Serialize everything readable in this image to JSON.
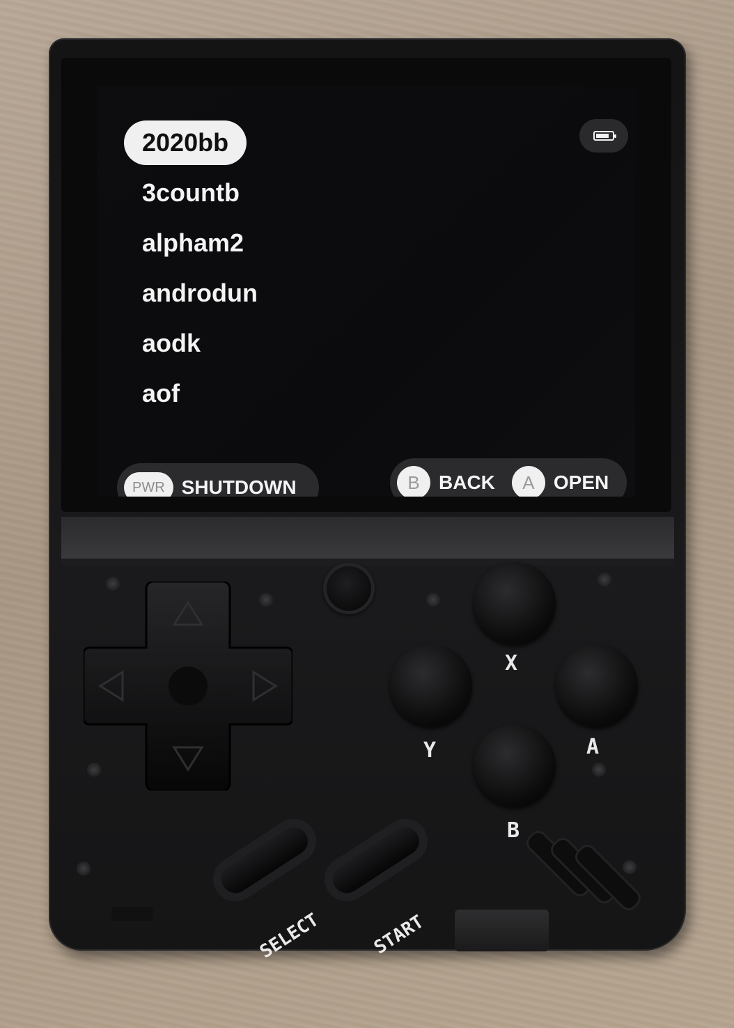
{
  "rom_list": {
    "items": [
      {
        "label": "2020bb",
        "selected": true
      },
      {
        "label": "3countb",
        "selected": false
      },
      {
        "label": "alpham2",
        "selected": false
      },
      {
        "label": "androdun",
        "selected": false
      },
      {
        "label": "aodk",
        "selected": false
      },
      {
        "label": "aof",
        "selected": false
      }
    ]
  },
  "status": {
    "battery_icon": "battery-icon",
    "battery_level": 0.8
  },
  "footer": {
    "shutdown": {
      "key": "PWR",
      "label": "SHUTDOWN"
    },
    "back": {
      "key": "B",
      "label": "BACK"
    },
    "open": {
      "key": "A",
      "label": "OPEN"
    }
  },
  "device": {
    "button_labels": {
      "x": "X",
      "y": "Y",
      "a": "A",
      "b": "B"
    },
    "select_label": "SELECT",
    "start_label": "START",
    "colors": {
      "body": "#141414",
      "screen": "#0d0d10",
      "highlight": "#f0f0f0"
    }
  }
}
